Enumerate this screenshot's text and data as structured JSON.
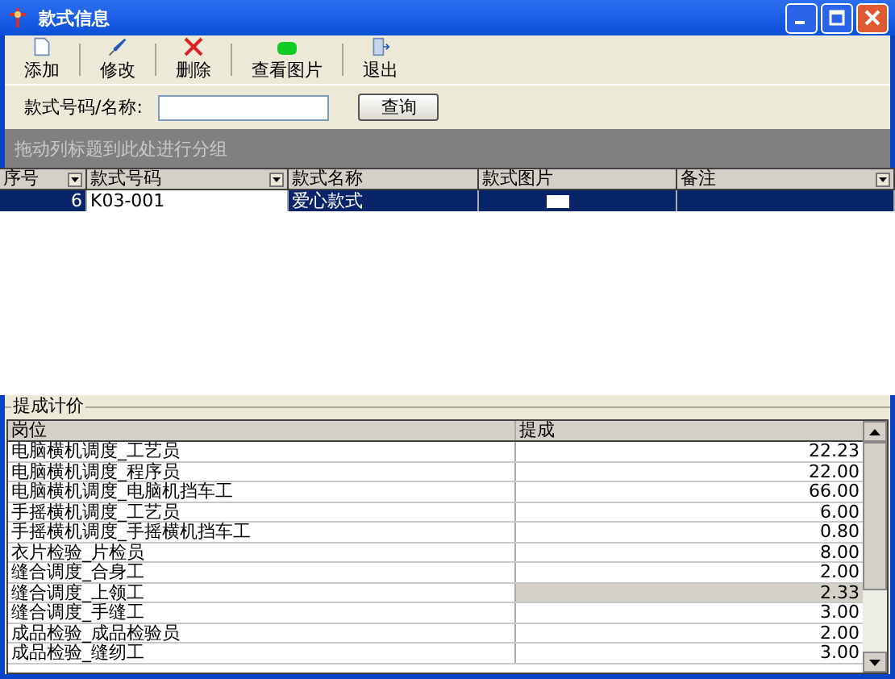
{
  "window": {
    "title": "款式信息"
  },
  "toolbar": [
    {
      "kind": "add",
      "label": "添加"
    },
    {
      "kind": "edit",
      "label": "修改"
    },
    {
      "kind": "delete",
      "label": "删除"
    },
    {
      "kind": "image",
      "label": "查看图片"
    },
    {
      "kind": "exit",
      "label": "退出"
    }
  ],
  "search": {
    "label": "款式号码/名称:",
    "button": "查询"
  },
  "group_panel": {
    "hint": "拖动列标题到此处进行分组"
  },
  "styles_table": {
    "columns": [
      {
        "label": "序号",
        "dropdown": true
      },
      {
        "label": "款式号码",
        "dropdown": true
      },
      {
        "label": "款式名称",
        "dropdown": false
      },
      {
        "label": "款式图片",
        "dropdown": false
      },
      {
        "label": "备注",
        "dropdown": true
      }
    ],
    "rows": [
      {
        "selected": true,
        "cells": [
          "6",
          "K03-001",
          "爱心款式",
          "",
          ""
        ]
      }
    ]
  },
  "commission": {
    "title": "提成计价",
    "columns": [
      "岗位",
      "提成"
    ],
    "rows": [
      {
        "post": "电脑横机调度_工艺员",
        "amount": "22.23",
        "selected": false
      },
      {
        "post": "电脑横机调度_程序员",
        "amount": "22.00",
        "selected": false
      },
      {
        "post": "电脑横机调度_电脑机挡车工",
        "amount": "66.00",
        "selected": false
      },
      {
        "post": "手摇横机调度_工艺员",
        "amount": "6.00",
        "selected": false
      },
      {
        "post": "手摇横机调度_手摇横机挡车工",
        "amount": "0.80",
        "selected": false
      },
      {
        "post": "衣片检验_片检员",
        "amount": "8.00",
        "selected": false
      },
      {
        "post": "缝合调度_合身工",
        "amount": "2.00",
        "selected": false
      },
      {
        "post": "缝合调度_上领工",
        "amount": "2.33",
        "selected": true
      },
      {
        "post": "缝合调度_手缝工",
        "amount": "3.00",
        "selected": false
      },
      {
        "post": "成品检验_成品检验员",
        "amount": "2.00",
        "selected": false
      },
      {
        "post": "成品检验_缝纫工",
        "amount": "3.00",
        "selected": false
      }
    ]
  }
}
